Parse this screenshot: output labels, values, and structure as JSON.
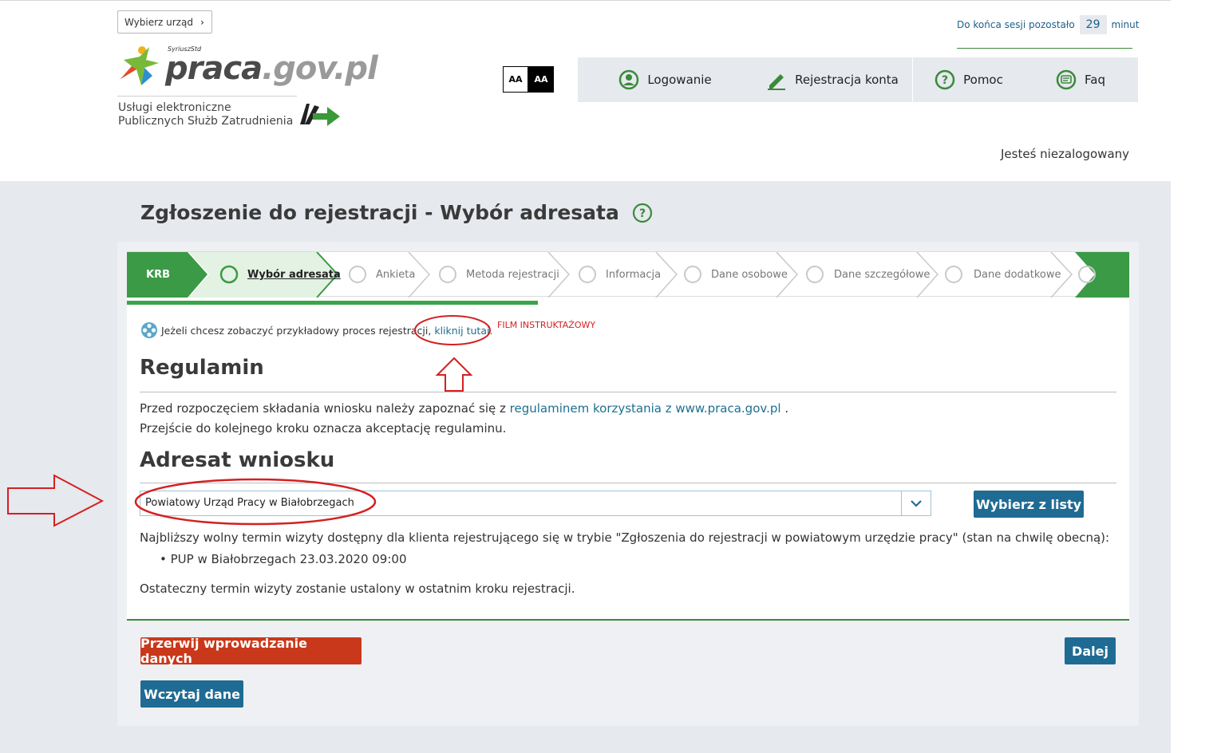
{
  "header": {
    "choose_office": "Wybierz urząd",
    "logo_super": "SyriuszStd",
    "logo_main": "praca",
    "logo_domain": ".gov.pl",
    "tagline_line1": "Usługi elektroniczne",
    "tagline_line2": "Publicznych Służb Zatrudnienia",
    "font_small": "AA",
    "font_large": "AA",
    "session_prefix": "Do końca sesji pozostało",
    "session_minutes": "29",
    "session_suffix": "minut",
    "nav": {
      "login": "Logowanie",
      "register": "Rejestracja konta",
      "help": "Pomoc",
      "faq": "Faq"
    },
    "login_status": "Jesteś niezalogowany"
  },
  "page": {
    "title": "Zgłoszenie do rejestracji - Wybór adresata"
  },
  "steps": {
    "items": [
      "KRB",
      "Wybór adresata",
      "Ankieta",
      "Metoda rejestracji",
      "Informacja",
      "Dane osobowe",
      "Dane szczegółowe",
      "Dane dodatkowe"
    ],
    "active_index": 1,
    "progress": 0.41
  },
  "film": {
    "text": "Jeżeli chcesz zobaczyć przykładowy proces rejestracji",
    "link": "kliknij tutaj",
    "annotation": "FILM INSTRUKTAŻOWY"
  },
  "regulamin": {
    "heading": "Regulamin",
    "line1_pre": "Przed rozpoczęciem składania wniosku należy zapoznać się z",
    "line1_link": "regulaminem korzystania z www.praca.gov.pl",
    "line1_post": ".",
    "line2": "Przejście do kolejnego kroku oznacza akceptację regulaminu."
  },
  "adresat": {
    "heading": "Adresat wniosku",
    "selected": "Powiatowy Urząd Pracy w Białobrzegach",
    "choose_button": "Wybierz z listy",
    "next_visit_text": "Najbliższy wolny termin wizyty dostępny dla klienta rejestrującego się w trybie \"Zgłoszenia do rejestracji w powiatowym urzędzie pracy\" (stan na chwilę obecną):",
    "visit_item": "PUP w Białobrzegach 23.03.2020 09:00",
    "final_note": "Ostateczny termin wizyty zostanie ustalony w ostatnim kroku rejestracji."
  },
  "actions": {
    "cancel": "Przerwij wprowadzanie danych",
    "next": "Dalej",
    "load": "Wczytaj dane"
  },
  "colors": {
    "accent_green": "#3a8a3a",
    "button_blue": "#1f6b93",
    "button_red": "#c9381a",
    "annotation_red": "#d42020"
  }
}
